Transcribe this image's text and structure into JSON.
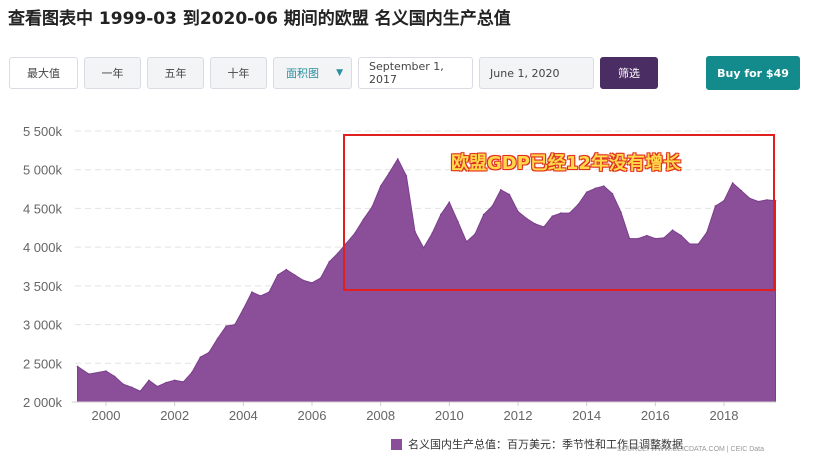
{
  "title": "查看图表中 1999-03 到2020-06 期间的欧盟 名义国内生产总值",
  "controls": {
    "max_label": "最大值",
    "one_year_label": "一年",
    "five_year_label": "五年",
    "ten_year_label": "十年",
    "chart_type_value": "面积图",
    "start_date_value": "September 1, 2017",
    "end_date_value": "June 1, 2020",
    "filter_label": "筛选",
    "buy_label": "Buy for $49"
  },
  "annotation": {
    "text": "欧盟GDP已经12年没有增长",
    "color": "#e02020"
  },
  "legend": {
    "label": "名义国内生产总值：百万美元：季节性和工作日调整数据"
  },
  "source": "SOURCE: WWW.CEICDATA.COM | CEIC Data",
  "colors": {
    "area": "#8b4f9a",
    "accent": "#138a8c",
    "filter": "#4a2d63"
  },
  "chart_data": {
    "type": "area",
    "ylim": [
      2000000,
      5500000
    ],
    "xlim": [
      1999.0,
      2020.5
    ],
    "y_ticks": [
      2000000,
      2500000,
      3000000,
      3500000,
      4000000,
      4500000,
      5000000,
      5500000
    ],
    "y_tick_labels": [
      "2 000k",
      "2 500k",
      "3 000k",
      "3 500k",
      "4 000k",
      "4 500k",
      "5 000k",
      "5 500k"
    ],
    "x_ticks": [
      2000,
      2002,
      2004,
      2006,
      2008,
      2010,
      2012,
      2014,
      2016,
      2018
    ],
    "x_tick_labels": [
      "2000",
      "2002",
      "2004",
      "2006",
      "2008",
      "2010",
      "2012",
      "2014",
      "2016",
      "2018"
    ],
    "grid": true,
    "legend_position": "bottom",
    "series": [
      {
        "x": [
          1999.17,
          1999.5,
          2000.0,
          2000.25,
          2000.5,
          2000.75,
          2001.0,
          2001.25,
          2001.5,
          2001.75,
          2002.0,
          2002.25,
          2002.5,
          2002.75,
          2003.0,
          2003.25,
          2003.5,
          2003.75,
          2004.0,
          2004.25,
          2004.5,
          2004.75,
          2005.0,
          2005.25,
          2005.5,
          2005.75,
          2006.0,
          2006.25,
          2006.5,
          2006.75,
          2007.0,
          2007.25,
          2007.5,
          2007.75,
          2008.0,
          2008.25,
          2008.5,
          2008.75,
          2009.0,
          2009.25,
          2009.5,
          2009.75,
          2010.0,
          2010.25,
          2010.5,
          2010.75,
          2011.0,
          2011.25,
          2011.5,
          2011.75,
          2012.0,
          2012.25,
          2012.5,
          2012.75,
          2013.0,
          2013.25,
          2013.5,
          2013.75,
          2014.0,
          2014.25,
          2014.5,
          2014.75,
          2015.0,
          2015.25,
          2015.5,
          2015.75,
          2016.0,
          2016.25,
          2016.5,
          2016.75,
          2017.0,
          2017.25,
          2017.5,
          2017.75,
          2018.0,
          2018.25,
          2018.5,
          2018.75,
          2019.0,
          2019.25,
          2019.5
        ],
        "values": [
          2460000,
          2360000,
          2400000,
          2330000,
          2230000,
          2190000,
          2140000,
          2280000,
          2200000,
          2250000,
          2280000,
          2260000,
          2380000,
          2580000,
          2640000,
          2820000,
          2980000,
          3000000,
          3200000,
          3420000,
          3370000,
          3420000,
          3640000,
          3710000,
          3640000,
          3570000,
          3540000,
          3600000,
          3810000,
          3920000,
          4050000,
          4180000,
          4360000,
          4520000,
          4790000,
          4960000,
          5140000,
          4920000,
          4200000,
          3990000,
          4180000,
          4420000,
          4580000,
          4330000,
          4070000,
          4170000,
          4420000,
          4530000,
          4740000,
          4680000,
          4460000,
          4370000,
          4300000,
          4260000,
          4400000,
          4440000,
          4440000,
          4550000,
          4710000,
          4760000,
          4790000,
          4690000,
          4450000,
          4110000,
          4110000,
          4150000,
          4110000,
          4120000,
          4220000,
          4150000,
          4040000,
          4040000,
          4190000,
          4530000,
          4600000,
          4830000,
          4730000,
          4630000,
          4590000,
          4610000,
          4600000
        ]
      }
    ]
  }
}
